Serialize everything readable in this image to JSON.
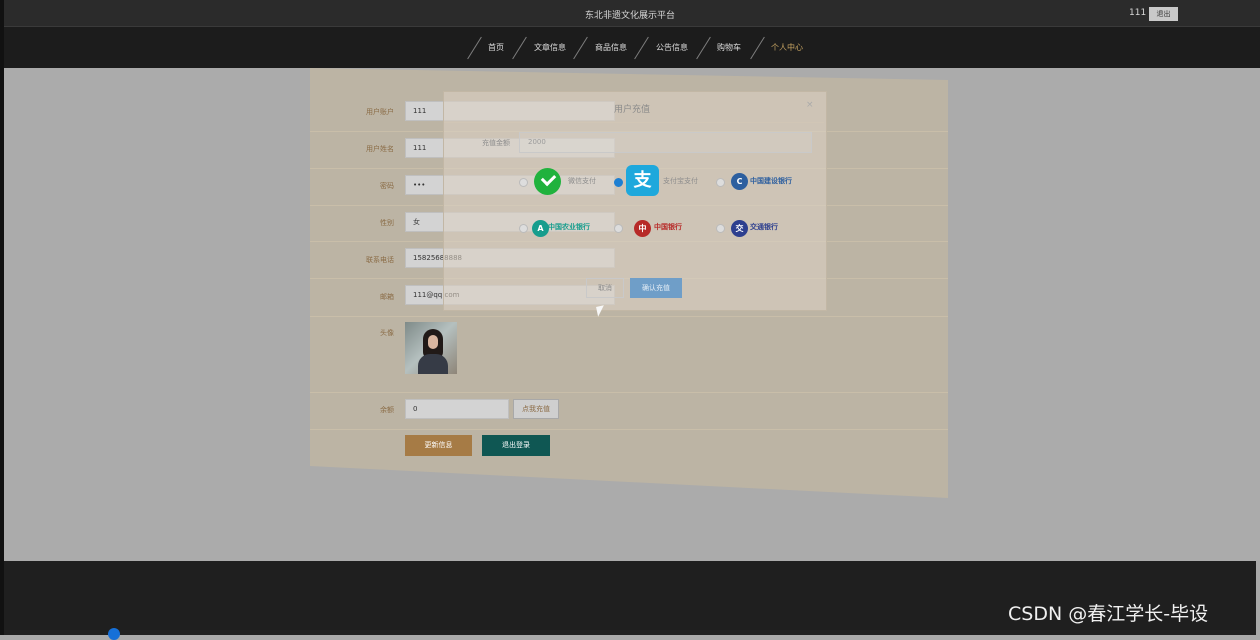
{
  "header": {
    "site_title": "东北非遗文化展示平台",
    "user_name": "111",
    "logout": "退出"
  },
  "nav": [
    {
      "label": "首页"
    },
    {
      "label": "文章信息"
    },
    {
      "label": "商品信息"
    },
    {
      "label": "公告信息"
    },
    {
      "label": "购物车"
    },
    {
      "label": "个人中心",
      "active": true
    }
  ],
  "profile": {
    "account_label": "用户账户",
    "account_value": "111",
    "name_label": "用户姓名",
    "name_value": "111",
    "password_label": "密码",
    "password_value": "•••",
    "gender_label": "性别",
    "gender_value": "女",
    "phone_label": "联系电话",
    "phone_value": "15825688888",
    "email_label": "邮箱",
    "email_value": "111@qq.com",
    "avatar_label": "头像",
    "balance_label": "余额",
    "balance_value": "0",
    "recharge_button": "点我充值",
    "update_button": "更新信息",
    "logout_button": "退出登录"
  },
  "modal": {
    "title": "用户充值",
    "close": "×",
    "amount_label": "充值金额",
    "amount_placeholder": "2000",
    "options": [
      {
        "label": "微信支付",
        "icon": "wechat-icon"
      },
      {
        "label": "支付宝支付",
        "icon": "alipay-icon",
        "checked": true
      },
      {
        "label": "中国建设银行",
        "icon": "ccb-icon"
      },
      {
        "label": "中国农业银行",
        "icon": "abc-icon"
      },
      {
        "label": "中国银行",
        "icon": "boc-icon"
      },
      {
        "label": "交通银行",
        "icon": "bocom-icon"
      }
    ],
    "cancel": "取消",
    "confirm": "确认充值"
  },
  "watermark": "CSDN @春江学长-毕设"
}
